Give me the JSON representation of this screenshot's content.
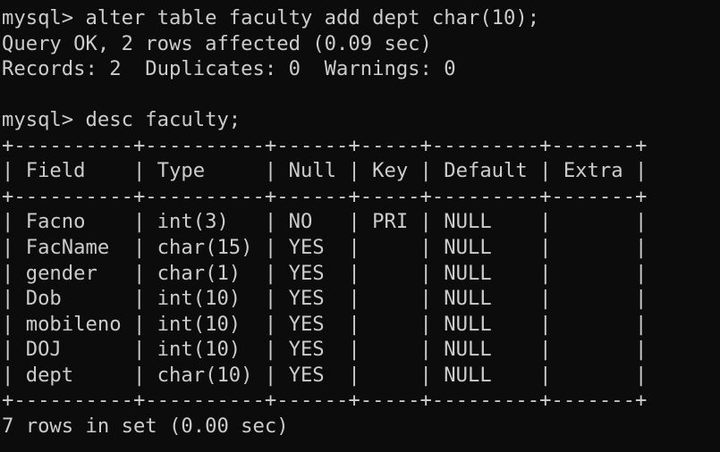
{
  "terminal": {
    "lines": [
      "mysql> alter table faculty add dept char(10);",
      "Query OK, 2 rows affected (0.09 sec)",
      "Records: 2  Duplicates: 0  Warnings: 0",
      "",
      "mysql> desc faculty;",
      "+----------+----------+------+-----+---------+-------+",
      "| Field    | Type     | Null | Key | Default | Extra |",
      "+----------+----------+------+-----+---------+-------+",
      "| Facno    | int(3)   | NO   | PRI | NULL    |       |",
      "| FacName  | char(15) | YES  |     | NULL    |       |",
      "| gender   | char(1)  | YES  |     | NULL    |       |",
      "| Dob      | int(10)  | YES  |     | NULL    |       |",
      "| mobileno | int(10)  | YES  |     | NULL    |       |",
      "| DOJ      | int(10)  | YES  |     | NULL    |       |",
      "| dept     | char(10) | YES  |     | NULL    |       |",
      "+----------+----------+------+-----+---------+-------+",
      "7 rows in set (0.00 sec)"
    ]
  }
}
